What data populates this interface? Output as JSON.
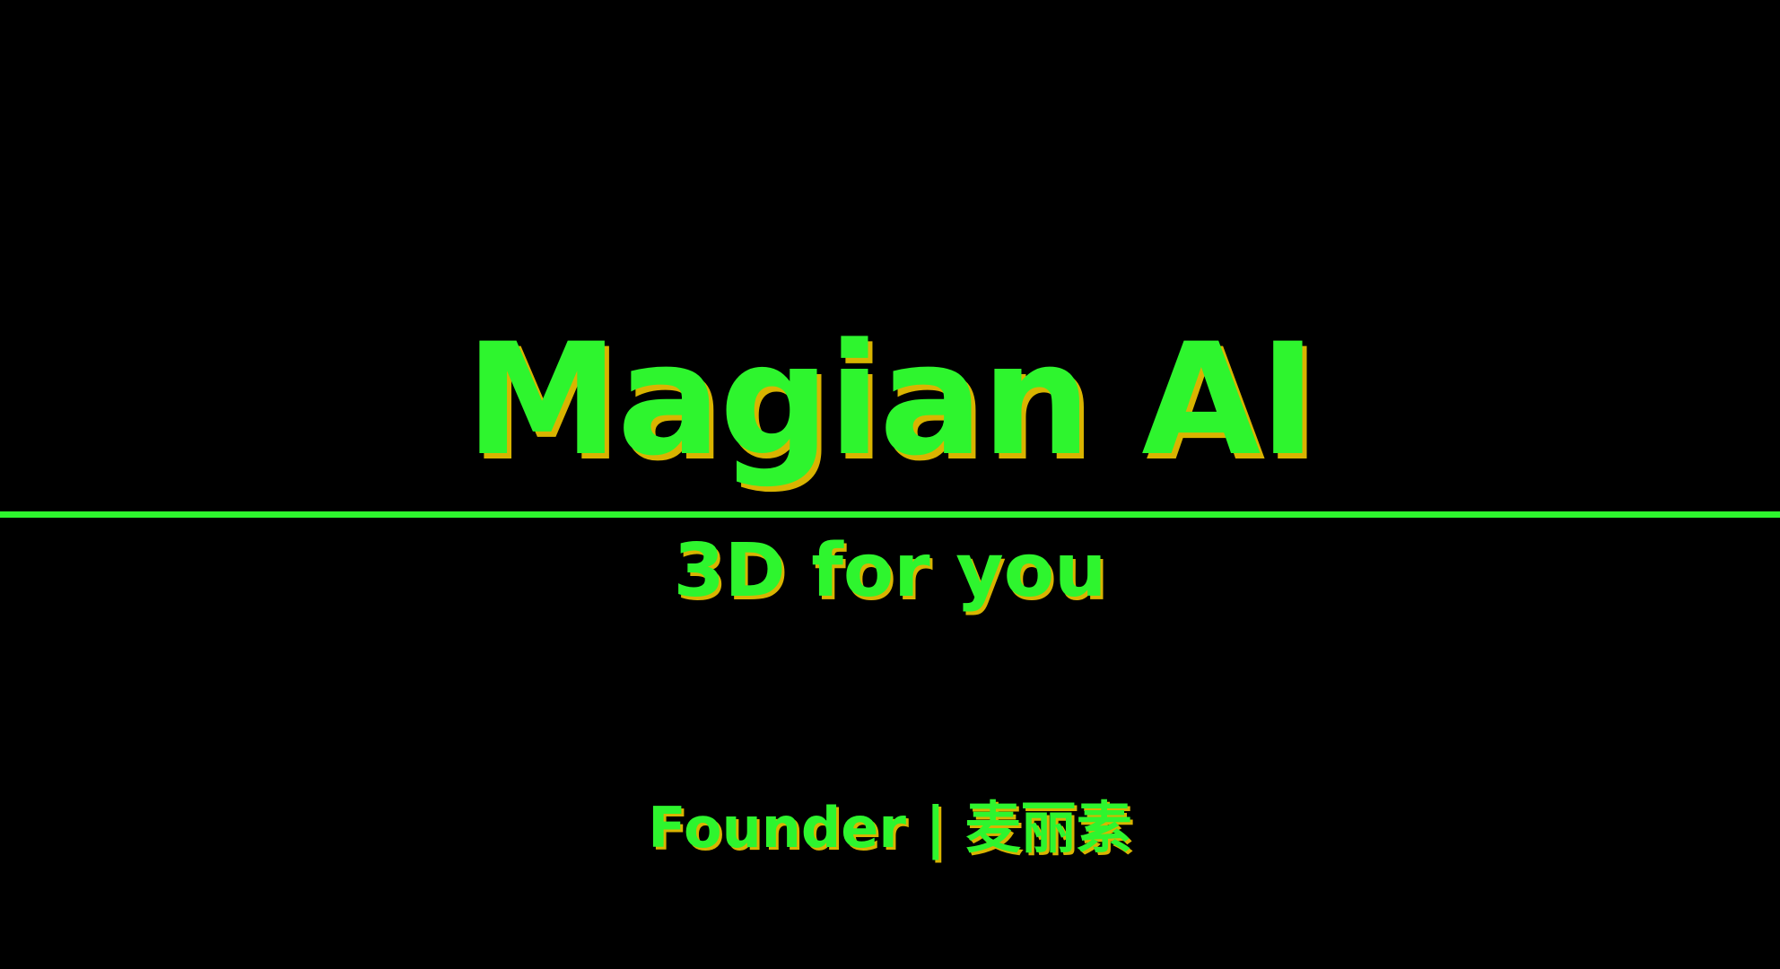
{
  "slide": {
    "title": "Magian AI",
    "subtitle": "3D for you",
    "founder_line": "Founder | 麦丽素"
  },
  "colors": {
    "background": "#000000",
    "text": "#2EF52E",
    "shadow": "#D9B400",
    "divider": "#2EF52E"
  }
}
